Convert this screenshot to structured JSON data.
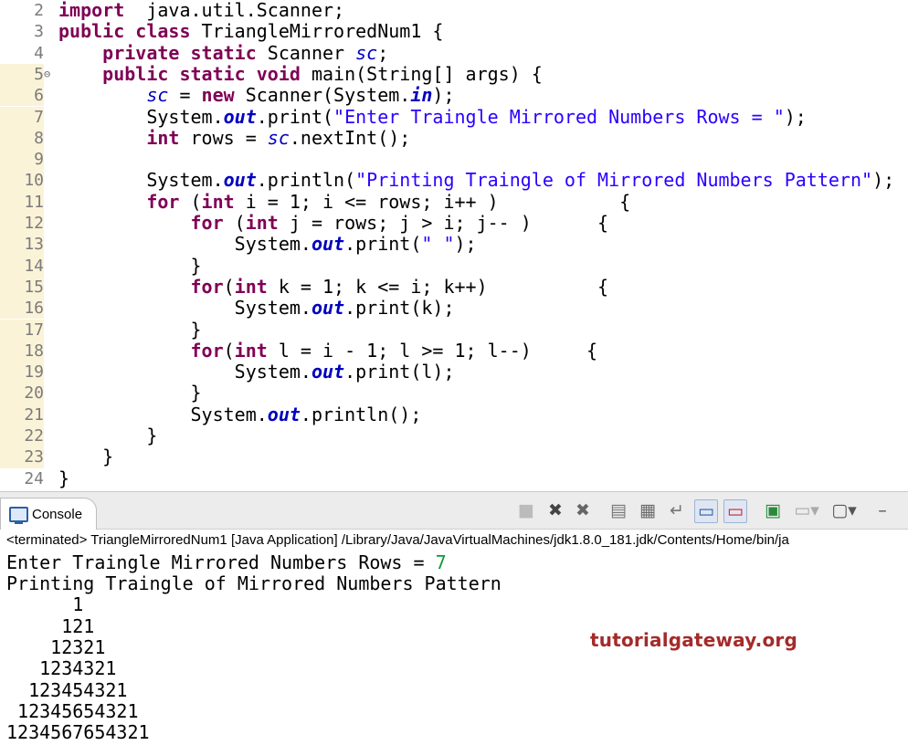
{
  "editor": {
    "lines": [
      {
        "n": "2",
        "segs": [
          [
            "kw",
            "import"
          ],
          [
            "",
            "  java.util.Scanner;"
          ]
        ]
      },
      {
        "n": "3",
        "segs": [
          [
            "kw",
            "public"
          ],
          [
            "",
            " "
          ],
          [
            "kw",
            "class"
          ],
          [
            "",
            " TriangleMirroredNum1 {"
          ]
        ]
      },
      {
        "n": "4",
        "segs": [
          [
            "",
            "    "
          ],
          [
            "kw",
            "private"
          ],
          [
            "",
            " "
          ],
          [
            "kw",
            "static"
          ],
          [
            "",
            " Scanner "
          ],
          [
            "fld",
            "sc"
          ],
          [
            "",
            ";"
          ]
        ]
      },
      {
        "n": "5",
        "segs": [
          [
            "",
            "    "
          ],
          [
            "kw",
            "public"
          ],
          [
            "",
            " "
          ],
          [
            "kw",
            "static"
          ],
          [
            "",
            " "
          ],
          [
            "kw",
            "void"
          ],
          [
            "",
            " main(String[] args) {"
          ]
        ]
      },
      {
        "n": "6",
        "segs": [
          [
            "",
            "        "
          ],
          [
            "fld",
            "sc"
          ],
          [
            "",
            " = "
          ],
          [
            "kw",
            "new"
          ],
          [
            "",
            " Scanner(System."
          ],
          [
            "sfld",
            "in"
          ],
          [
            "",
            ");"
          ]
        ]
      },
      {
        "n": "7",
        "segs": [
          [
            "",
            "        System."
          ],
          [
            "sfld",
            "out"
          ],
          [
            "",
            ".print("
          ],
          [
            "str",
            "\"Enter Traingle Mirrored Numbers Rows = \""
          ],
          [
            "",
            ");"
          ]
        ]
      },
      {
        "n": "8",
        "segs": [
          [
            "",
            "        "
          ],
          [
            "kw",
            "int"
          ],
          [
            "",
            " rows = "
          ],
          [
            "fld",
            "sc"
          ],
          [
            "",
            ".nextInt();"
          ]
        ]
      },
      {
        "n": "9",
        "segs": [
          [
            "",
            ""
          ]
        ]
      },
      {
        "n": "10",
        "segs": [
          [
            "",
            "        System."
          ],
          [
            "sfld",
            "out"
          ],
          [
            "",
            ".println("
          ],
          [
            "str",
            "\"Printing Traingle of Mirrored Numbers Pattern\""
          ],
          [
            "",
            ");"
          ]
        ]
      },
      {
        "n": "11",
        "segs": [
          [
            "",
            "        "
          ],
          [
            "kw",
            "for"
          ],
          [
            "",
            " ("
          ],
          [
            "kw",
            "int"
          ],
          [
            "",
            " i = 1; i <= rows; i++ )           {"
          ]
        ]
      },
      {
        "n": "12",
        "segs": [
          [
            "",
            "            "
          ],
          [
            "kw",
            "for"
          ],
          [
            "",
            " ("
          ],
          [
            "kw",
            "int"
          ],
          [
            "",
            " j = rows; j > i; j-- )      {"
          ]
        ]
      },
      {
        "n": "13",
        "segs": [
          [
            "",
            "                System."
          ],
          [
            "sfld",
            "out"
          ],
          [
            "",
            ".print("
          ],
          [
            "str",
            "\" \""
          ],
          [
            "",
            ");"
          ]
        ]
      },
      {
        "n": "14",
        "segs": [
          [
            "",
            "            }"
          ]
        ]
      },
      {
        "n": "15",
        "segs": [
          [
            "",
            "            "
          ],
          [
            "kw",
            "for"
          ],
          [
            "",
            "("
          ],
          [
            "kw",
            "int"
          ],
          [
            "",
            " k = 1; k <= i; k++)          {"
          ]
        ]
      },
      {
        "n": "16",
        "segs": [
          [
            "",
            "                System."
          ],
          [
            "sfld",
            "out"
          ],
          [
            "",
            ".print(k);"
          ]
        ]
      },
      {
        "n": "17",
        "segs": [
          [
            "",
            "            }"
          ]
        ]
      },
      {
        "n": "18",
        "segs": [
          [
            "",
            "            "
          ],
          [
            "kw",
            "for"
          ],
          [
            "",
            "("
          ],
          [
            "kw",
            "int"
          ],
          [
            "",
            " l = i - 1; l >= 1; l--)     {"
          ]
        ]
      },
      {
        "n": "19",
        "segs": [
          [
            "",
            "                System."
          ],
          [
            "sfld",
            "out"
          ],
          [
            "",
            ".print(l);"
          ]
        ]
      },
      {
        "n": "20",
        "segs": [
          [
            "",
            "            }"
          ]
        ]
      },
      {
        "n": "21",
        "segs": [
          [
            "",
            "            System."
          ],
          [
            "sfld",
            "out"
          ],
          [
            "",
            ".println();"
          ]
        ]
      },
      {
        "n": "22",
        "segs": [
          [
            "",
            "        }"
          ]
        ]
      },
      {
        "n": "23",
        "segs": [
          [
            "",
            "    }"
          ]
        ]
      },
      {
        "n": "24",
        "segs": [
          [
            "",
            "}"
          ]
        ]
      }
    ],
    "fold_marker": "⊖"
  },
  "console": {
    "tab_label": "Console",
    "status": "<terminated> TriangleMirroredNum1 [Java Application] /Library/Java/JavaVirtualMachines/jdk1.8.0_181.jdk/Contents/Home/bin/ja",
    "prompt": "Enter Traingle Mirrored Numbers Rows = ",
    "input_value": "7",
    "output_lines": [
      "Printing Traingle of Mirrored Numbers Pattern",
      "      1",
      "     121",
      "    12321",
      "   1234321",
      "  123454321",
      " 12345654321",
      "1234567654321"
    ],
    "toolbar_icons": [
      "terminate-icon",
      "remove-launch-icon",
      "remove-all-icon",
      "scroll-lock-icon",
      "clear-console-icon",
      "word-wrap-icon",
      "show-on-stdout-icon",
      "show-on-stderr-icon",
      "pin-console-icon",
      "display-console-icon",
      "open-console-icon",
      "minimize-icon"
    ]
  },
  "watermark": "tutorialgateway.org",
  "colors": {
    "keyword": "#7f0055",
    "string": "#2a00ff",
    "field": "#0000c0",
    "input": "#0c9a3c",
    "watermark": "#a52a2a"
  }
}
